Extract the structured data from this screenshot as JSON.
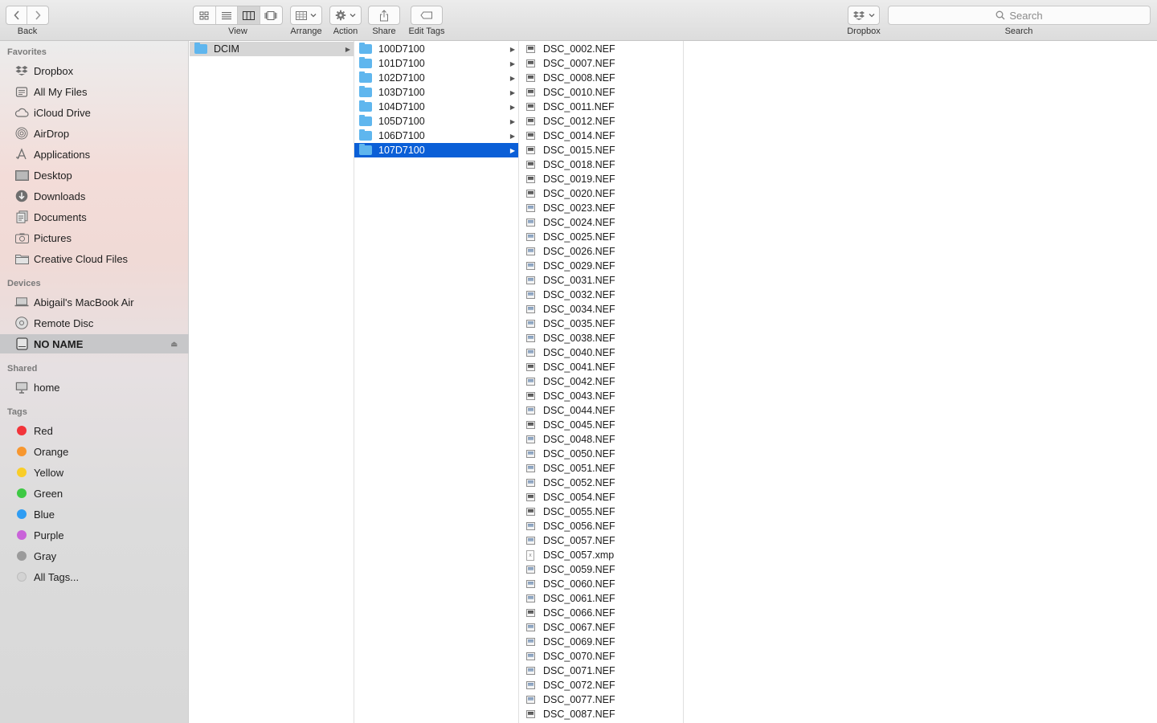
{
  "toolbar": {
    "back_label": "Back",
    "view_label": "View",
    "arrange_label": "Arrange",
    "action_label": "Action",
    "share_label": "Share",
    "edit_tags_label": "Edit Tags",
    "dropbox_label": "Dropbox",
    "search_label": "Search",
    "search_placeholder": "Search"
  },
  "sidebar": {
    "favorites_heading": "Favorites",
    "favorites": [
      {
        "label": "Dropbox",
        "icon": "dropbox-icon"
      },
      {
        "label": "All My Files",
        "icon": "all-files-icon"
      },
      {
        "label": "iCloud Drive",
        "icon": "cloud-icon"
      },
      {
        "label": "AirDrop",
        "icon": "airdrop-icon"
      },
      {
        "label": "Applications",
        "icon": "applications-icon"
      },
      {
        "label": "Desktop",
        "icon": "desktop-icon"
      },
      {
        "label": "Downloads",
        "icon": "downloads-icon"
      },
      {
        "label": "Documents",
        "icon": "documents-icon"
      },
      {
        "label": "Pictures",
        "icon": "pictures-icon"
      },
      {
        "label": "Creative Cloud Files",
        "icon": "folder-icon"
      }
    ],
    "devices_heading": "Devices",
    "devices": [
      {
        "label": "Abigail's MacBook Air",
        "icon": "laptop-icon"
      },
      {
        "label": "Remote Disc",
        "icon": "disc-icon"
      },
      {
        "label": "NO NAME",
        "icon": "drive-icon",
        "selected": true
      }
    ],
    "shared_heading": "Shared",
    "shared": [
      {
        "label": "home",
        "icon": "monitor-icon"
      }
    ],
    "tags_heading": "Tags",
    "tags": [
      {
        "label": "Red",
        "color": "#f2343a"
      },
      {
        "label": "Orange",
        "color": "#f7972f"
      },
      {
        "label": "Yellow",
        "color": "#f9cd28"
      },
      {
        "label": "Green",
        "color": "#3ec944"
      },
      {
        "label": "Blue",
        "color": "#2f9df3"
      },
      {
        "label": "Purple",
        "color": "#c963d9"
      },
      {
        "label": "Gray",
        "color": "#9b9b9b"
      },
      {
        "label": "All Tags...",
        "color": "#d3d3d3"
      }
    ]
  },
  "columns": {
    "col1": [
      {
        "name": "DCIM",
        "type": "folder",
        "selected": "gray"
      }
    ],
    "col2": [
      {
        "name": "100D7100"
      },
      {
        "name": "101D7100"
      },
      {
        "name": "102D7100"
      },
      {
        "name": "103D7100"
      },
      {
        "name": "104D7100"
      },
      {
        "name": "105D7100"
      },
      {
        "name": "106D7100"
      },
      {
        "name": "107D7100",
        "selected": "blue"
      }
    ],
    "col3": [
      "DSC_0002.NEF",
      "DSC_0007.NEF",
      "DSC_0008.NEF",
      "DSC_0010.NEF",
      "DSC_0011.NEF",
      "DSC_0012.NEF",
      "DSC_0014.NEF",
      "DSC_0015.NEF",
      "DSC_0018.NEF",
      "DSC_0019.NEF",
      "DSC_0020.NEF",
      "DSC_0023.NEF",
      "DSC_0024.NEF",
      "DSC_0025.NEF",
      "DSC_0026.NEF",
      "DSC_0029.NEF",
      "DSC_0031.NEF",
      "DSC_0032.NEF",
      "DSC_0034.NEF",
      "DSC_0035.NEF",
      "DSC_0038.NEF",
      "DSC_0040.NEF",
      "DSC_0041.NEF",
      "DSC_0042.NEF",
      "DSC_0043.NEF",
      "DSC_0044.NEF",
      "DSC_0045.NEF",
      "DSC_0048.NEF",
      "DSC_0050.NEF",
      "DSC_0051.NEF",
      "DSC_0052.NEF",
      "DSC_0054.NEF",
      "DSC_0055.NEF",
      "DSC_0056.NEF",
      "DSC_0057.NEF",
      "DSC_0057.xmp",
      "DSC_0059.NEF",
      "DSC_0060.NEF",
      "DSC_0061.NEF",
      "DSC_0066.NEF",
      "DSC_0067.NEF",
      "DSC_0069.NEF",
      "DSC_0070.NEF",
      "DSC_0071.NEF",
      "DSC_0072.NEF",
      "DSC_0077.NEF",
      "DSC_0087.NEF"
    ]
  }
}
